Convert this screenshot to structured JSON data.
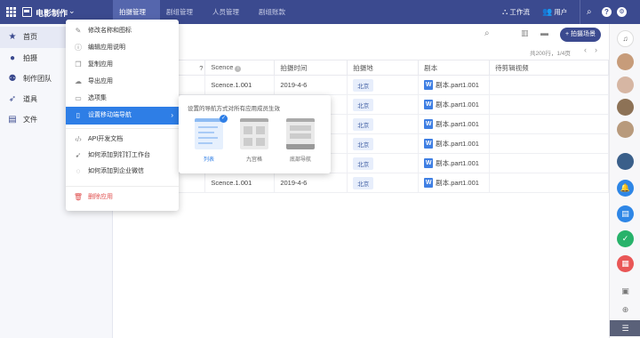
{
  "app": {
    "name": "电影制作"
  },
  "topnav": {
    "tabs": [
      {
        "label": "拍摄管理",
        "active": true
      },
      {
        "label": "剧组管理",
        "active": false
      },
      {
        "label": "人员管理",
        "active": false
      },
      {
        "label": "剧组账款",
        "active": false
      }
    ],
    "workflow_label": "工作流",
    "user_label": "用户"
  },
  "sidebar": {
    "items": [
      {
        "label": "首页",
        "icon": "star-icon",
        "active": true
      },
      {
        "label": "拍摄",
        "icon": "person-icon",
        "active": false
      },
      {
        "label": "制作团队",
        "icon": "team-icon",
        "active": false
      },
      {
        "label": "道具",
        "icon": "rocket-icon",
        "active": false
      },
      {
        "label": "文件",
        "icon": "file-icon",
        "active": false
      }
    ]
  },
  "toolbar": {
    "add_label": "+ 拍摄场景",
    "page_info": "共200行，1/4页"
  },
  "table": {
    "columns": [
      "?",
      "Scence",
      "拍摄时间",
      "拍摄地",
      "剧本",
      "待剪辑视频"
    ],
    "rows": [
      {
        "scene": "Scence.1.001",
        "date": "2019-4-6",
        "location": "北京",
        "script": "剧本.part1.001"
      },
      {
        "scene": "",
        "date": "",
        "location": "北京",
        "script": "剧本.part1.001"
      },
      {
        "scene": "",
        "date": "",
        "location": "北京",
        "script": "剧本.part1.001"
      },
      {
        "scene": "",
        "date": "",
        "location": "北京",
        "script": "剧本.part1.001"
      },
      {
        "scene": "",
        "date": "",
        "location": "北京",
        "script": "剧本.part1.001"
      },
      {
        "scene": "Scence.1.001",
        "date": "2019-4-6",
        "location": "北京",
        "script": "剧本.part1.001"
      }
    ]
  },
  "menu": {
    "items": [
      {
        "label": "修改名称和图标",
        "icon": "pencil-icon"
      },
      {
        "label": "编辑应用说明",
        "icon": "info-icon"
      },
      {
        "label": "复制应用",
        "icon": "copy-icon"
      },
      {
        "label": "导出应用",
        "icon": "cloud-download-icon"
      },
      {
        "label": "选项集",
        "icon": "option-set-icon"
      },
      {
        "label": "设置移动端导航",
        "icon": "mobile-icon",
        "active": true
      },
      {
        "label": "API开发文档",
        "icon": "code-icon"
      },
      {
        "label": "如何添加到钉钉工作台",
        "icon": "dingtalk-icon"
      },
      {
        "label": "如何添加到企业微信",
        "icon": "wecom-icon"
      },
      {
        "label": "删除应用",
        "icon": "trash-icon",
        "danger": true
      }
    ]
  },
  "submenu": {
    "hint": "设置的导航方式对所有应用成员生效",
    "options": [
      {
        "label": "列表",
        "selected": true
      },
      {
        "label": "九宫格",
        "selected": false
      },
      {
        "label": "底部导航",
        "selected": false
      }
    ]
  },
  "colors": {
    "brand": "#3b4a8f",
    "accent": "#2e7ee6",
    "danger": "#e0504f"
  }
}
